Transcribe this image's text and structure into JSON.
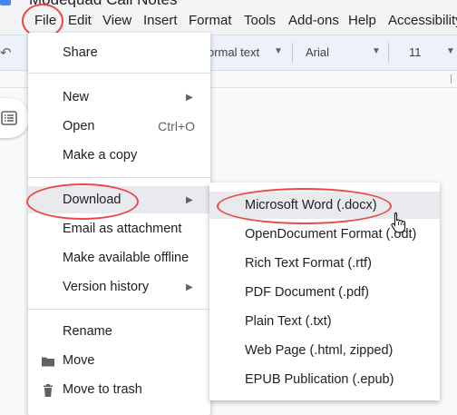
{
  "title": {
    "doc_name": "Modequad Call Notes"
  },
  "menubar": {
    "items": [
      "File",
      "Edit",
      "View",
      "Insert",
      "Format",
      "Tools",
      "Add-ons",
      "Help",
      "Accessibility"
    ]
  },
  "toolbar": {
    "style_value": "ormal text",
    "font_value": "Arial",
    "size_value": "11"
  },
  "file_menu": {
    "share": "Share",
    "new": "New",
    "open": "Open",
    "open_shortcut": "Ctrl+O",
    "make_copy": "Make a copy",
    "download": "Download",
    "email": "Email as attachment",
    "offline": "Make available offline",
    "version_history": "Version history",
    "rename": "Rename",
    "move": "Move",
    "trash": "Move to trash"
  },
  "download_menu": {
    "items": [
      "Microsoft Word (.docx)",
      "OpenDocument Format (.odt)",
      "Rich Text Format (.rtf)",
      "PDF Document (.pdf)",
      "Plain Text (.txt)",
      "Web Page (.html, zipped)",
      "EPUB Publication (.epub)"
    ]
  },
  "icons": {
    "doc": "docs-logo-icon",
    "outline": "outline-list-icon",
    "move": "folder-icon",
    "trash": "trash-icon",
    "cursor": "hand-pointer-icon"
  },
  "colors": {
    "highlight": "#e84a4a",
    "hover": "#e8eaed",
    "docs_blue": "#4285f4"
  }
}
